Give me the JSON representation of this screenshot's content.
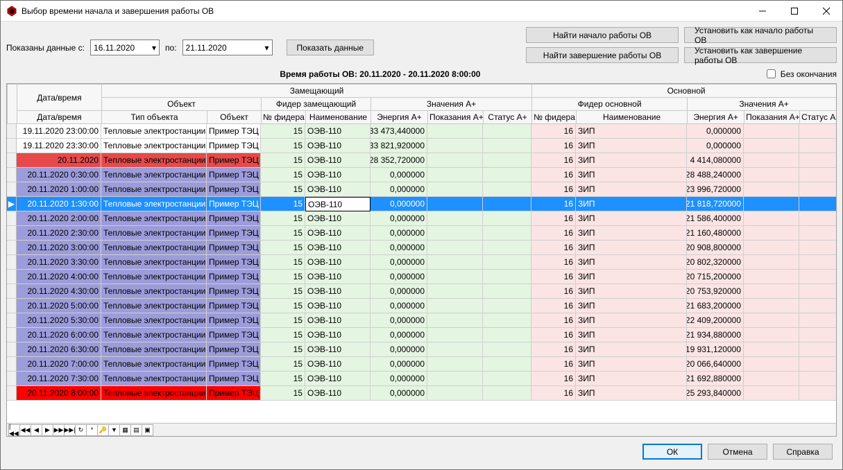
{
  "window": {
    "title": "Выбор времени начала и завершения работы ОВ"
  },
  "filter": {
    "shown_from_label": "Показаны данные с:",
    "to_label": "по:",
    "date_from": "16.11.2020",
    "date_to": "21.11.2020",
    "show_btn": "Показать данные"
  },
  "actions": {
    "find_start": "Найти начало работы ОВ",
    "set_start": "Установить как начало работы ОВ",
    "find_end": "Найти завершение работы ОВ",
    "set_end": "Установить как завершение работы ОВ"
  },
  "work_period": {
    "label": "Время работы ОВ: 20.11.2020 - 20.11.2020 8:00:00",
    "no_end_label": "Без окончания",
    "no_end_checked": false
  },
  "header": {
    "datetime_group": "Дата/время",
    "sub_group": "Замещающий",
    "main_group": "Основной",
    "object_group": "Объект",
    "feeder_sub": "Фидер замещающий",
    "values_a": "Значения A+",
    "feeder_main": "Фидер основной",
    "datetime": "Дата/время",
    "tip": "Тип объекта",
    "object": "Объект",
    "feeder_no": "№ фидера",
    "name": "Наименование",
    "energy": "Энергия A+",
    "readings": "Показания A+",
    "status": "Статус A+"
  },
  "rows": [
    {
      "style": "plain",
      "dt": "19.11.2020 23:00:00",
      "tip": "Тепловые электростанции",
      "obj": "Пример ТЭЦ",
      "nf1": "15",
      "nm1": "ОЭВ-110",
      "ea1": "33 473,440000",
      "pa1": "",
      "sa1": "",
      "nf2": "16",
      "nm2": "ЗИП",
      "ea2": "0,000000",
      "pa2": "",
      "sa2": ""
    },
    {
      "style": "plain",
      "dt": "19.11.2020 23:30:00",
      "tip": "Тепловые электростанции",
      "obj": "Пример ТЭЦ",
      "nf1": "15",
      "nm1": "ОЭВ-110",
      "ea1": "33 821,920000",
      "pa1": "",
      "sa1": "",
      "nf2": "16",
      "nm2": "ЗИП",
      "ea2": "0,000000",
      "pa2": "",
      "sa2": ""
    },
    {
      "style": "crimson",
      "dt": "20.11.2020",
      "tip": "Тепловые электростанции",
      "obj": "Пример ТЭЦ",
      "nf1": "15",
      "nm1": "ОЭВ-110",
      "ea1": "28 352,720000",
      "pa1": "",
      "sa1": "",
      "nf2": "16",
      "nm2": "ЗИП",
      "ea2": "4 414,080000",
      "pa2": "",
      "sa2": ""
    },
    {
      "style": "purple",
      "dt": "20.11.2020 0:30:00",
      "tip": "Тепловые электростанции",
      "obj": "Пример ТЭЦ",
      "nf1": "15",
      "nm1": "ОЭВ-110",
      "ea1": "0,000000",
      "pa1": "",
      "sa1": "",
      "nf2": "16",
      "nm2": "ЗИП",
      "ea2": "28 488,240000",
      "pa2": "",
      "sa2": ""
    },
    {
      "style": "purple",
      "dt": "20.11.2020 1:00:00",
      "tip": "Тепловые электростанции",
      "obj": "Пример ТЭЦ",
      "nf1": "15",
      "nm1": "ОЭВ-110",
      "ea1": "0,000000",
      "pa1": "",
      "sa1": "",
      "nf2": "16",
      "nm2": "ЗИП",
      "ea2": "23 996,720000",
      "pa2": "",
      "sa2": ""
    },
    {
      "style": "purple",
      "selected": true,
      "dt": "20.11.2020 1:30:00",
      "tip": "Тепловые электростанции",
      "obj": "Пример ТЭЦ",
      "nf1": "15",
      "nm1": "ОЭВ-110",
      "ea1": "0,000000",
      "pa1": "",
      "sa1": "",
      "nf2": "16",
      "nm2": "ЗИП",
      "ea2": "21 818,720000",
      "pa2": "",
      "sa2": ""
    },
    {
      "style": "purple",
      "dt": "20.11.2020 2:00:00",
      "tip": "Тепловые электростанции",
      "obj": "Пример ТЭЦ",
      "nf1": "15",
      "nm1": "ОЭВ-110",
      "ea1": "0,000000",
      "pa1": "",
      "sa1": "",
      "nf2": "16",
      "nm2": "ЗИП",
      "ea2": "21 586,400000",
      "pa2": "",
      "sa2": ""
    },
    {
      "style": "purple",
      "dt": "20.11.2020 2:30:00",
      "tip": "Тепловые электростанции",
      "obj": "Пример ТЭЦ",
      "nf1": "15",
      "nm1": "ОЭВ-110",
      "ea1": "0,000000",
      "pa1": "",
      "sa1": "",
      "nf2": "16",
      "nm2": "ЗИП",
      "ea2": "21 160,480000",
      "pa2": "",
      "sa2": ""
    },
    {
      "style": "purple",
      "dt": "20.11.2020 3:00:00",
      "tip": "Тепловые электростанции",
      "obj": "Пример ТЭЦ",
      "nf1": "15",
      "nm1": "ОЭВ-110",
      "ea1": "0,000000",
      "pa1": "",
      "sa1": "",
      "nf2": "16",
      "nm2": "ЗИП",
      "ea2": "20 908,800000",
      "pa2": "",
      "sa2": ""
    },
    {
      "style": "purple",
      "dt": "20.11.2020 3:30:00",
      "tip": "Тепловые электростанции",
      "obj": "Пример ТЭЦ",
      "nf1": "15",
      "nm1": "ОЭВ-110",
      "ea1": "0,000000",
      "pa1": "",
      "sa1": "",
      "nf2": "16",
      "nm2": "ЗИП",
      "ea2": "20 802,320000",
      "pa2": "",
      "sa2": ""
    },
    {
      "style": "purple",
      "dt": "20.11.2020 4:00:00",
      "tip": "Тепловые электростанции",
      "obj": "Пример ТЭЦ",
      "nf1": "15",
      "nm1": "ОЭВ-110",
      "ea1": "0,000000",
      "pa1": "",
      "sa1": "",
      "nf2": "16",
      "nm2": "ЗИП",
      "ea2": "20 715,200000",
      "pa2": "",
      "sa2": ""
    },
    {
      "style": "purple",
      "dt": "20.11.2020 4:30:00",
      "tip": "Тепловые электростанции",
      "obj": "Пример ТЭЦ",
      "nf1": "15",
      "nm1": "ОЭВ-110",
      "ea1": "0,000000",
      "pa1": "",
      "sa1": "",
      "nf2": "16",
      "nm2": "ЗИП",
      "ea2": "20 753,920000",
      "pa2": "",
      "sa2": ""
    },
    {
      "style": "purple",
      "dt": "20.11.2020 5:00:00",
      "tip": "Тепловые электростанции",
      "obj": "Пример ТЭЦ",
      "nf1": "15",
      "nm1": "ОЭВ-110",
      "ea1": "0,000000",
      "pa1": "",
      "sa1": "",
      "nf2": "16",
      "nm2": "ЗИП",
      "ea2": "21 683,200000",
      "pa2": "",
      "sa2": ""
    },
    {
      "style": "purple",
      "dt": "20.11.2020 5:30:00",
      "tip": "Тепловые электростанции",
      "obj": "Пример ТЭЦ",
      "nf1": "15",
      "nm1": "ОЭВ-110",
      "ea1": "0,000000",
      "pa1": "",
      "sa1": "",
      "nf2": "16",
      "nm2": "ЗИП",
      "ea2": "22 409,200000",
      "pa2": "",
      "sa2": ""
    },
    {
      "style": "purple",
      "dt": "20.11.2020 6:00:00",
      "tip": "Тепловые электростанции",
      "obj": "Пример ТЭЦ",
      "nf1": "15",
      "nm1": "ОЭВ-110",
      "ea1": "0,000000",
      "pa1": "",
      "sa1": "",
      "nf2": "16",
      "nm2": "ЗИП",
      "ea2": "21 934,880000",
      "pa2": "",
      "sa2": ""
    },
    {
      "style": "purple",
      "dt": "20.11.2020 6:30:00",
      "tip": "Тепловые электростанции",
      "obj": "Пример ТЭЦ",
      "nf1": "15",
      "nm1": "ОЭВ-110",
      "ea1": "0,000000",
      "pa1": "",
      "sa1": "",
      "nf2": "16",
      "nm2": "ЗИП",
      "ea2": "19 931,120000",
      "pa2": "",
      "sa2": ""
    },
    {
      "style": "purple",
      "dt": "20.11.2020 7:00:00",
      "tip": "Тепловые электростанции",
      "obj": "Пример ТЭЦ",
      "nf1": "15",
      "nm1": "ОЭВ-110",
      "ea1": "0,000000",
      "pa1": "",
      "sa1": "",
      "nf2": "16",
      "nm2": "ЗИП",
      "ea2": "20 066,640000",
      "pa2": "",
      "sa2": ""
    },
    {
      "style": "purple",
      "dt": "20.11.2020 7:30:00",
      "tip": "Тепловые электростанции",
      "obj": "Пример ТЭЦ",
      "nf1": "15",
      "nm1": "ОЭВ-110",
      "ea1": "0,000000",
      "pa1": "",
      "sa1": "",
      "nf2": "16",
      "nm2": "ЗИП",
      "ea2": "21 692,880000",
      "pa2": "",
      "sa2": ""
    },
    {
      "style": "red",
      "dt": "20.11.2020 8:00:00",
      "tip": "Тепловые электростанции",
      "obj": "Пример ТЭЦ",
      "nf1": "15",
      "nm1": "ОЭВ-110",
      "ea1": "0,000000",
      "pa1": "",
      "sa1": "",
      "nf2": "16",
      "nm2": "ЗИП",
      "ea2": "25 293,840000",
      "pa2": "",
      "sa2": ""
    }
  ],
  "nav": {
    "first": "|◀◀",
    "prevpg": "◀◀",
    "prev": "◀",
    "next": "▶",
    "nextpg": "▶▶",
    "last": "▶▶|",
    "refresh": "↻",
    "star": "*",
    "key": "🔑",
    "filter": "▼",
    "cols": "▦",
    "grid": "▤",
    "export": "▣"
  },
  "footer": {
    "ok": "ОК",
    "cancel": "Отмена",
    "help": "Справка"
  }
}
